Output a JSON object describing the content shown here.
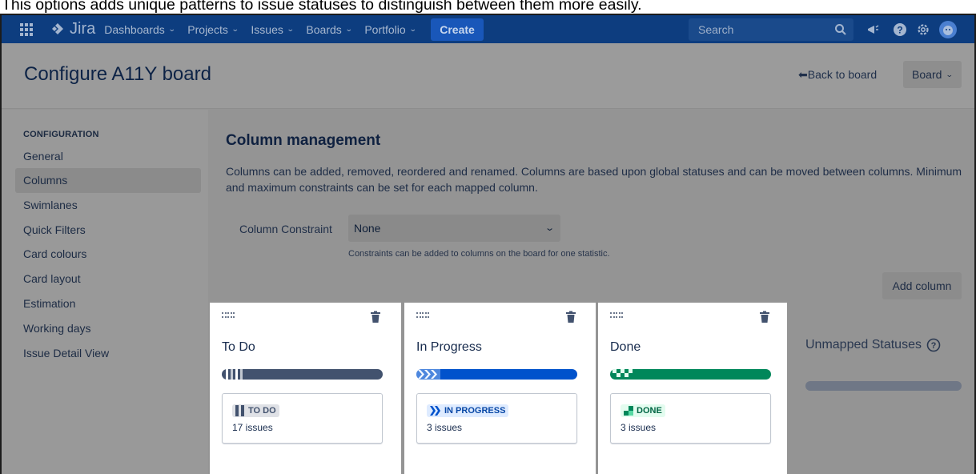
{
  "caption": "This options adds unique patterns to issue statuses to distinguish between them more easily.",
  "nav": {
    "product": "Jira",
    "items": [
      "Dashboards",
      "Projects",
      "Issues",
      "Boards",
      "Portfolio"
    ],
    "create_label": "Create",
    "search_placeholder": "Search"
  },
  "header": {
    "title": "Configure A11Y board",
    "back_label": "Back to board",
    "board_button": "Board"
  },
  "sidebar": {
    "heading": "CONFIGURATION",
    "items": [
      "General",
      "Columns",
      "Swimlanes",
      "Quick Filters",
      "Card colours",
      "Card layout",
      "Estimation",
      "Working days",
      "Issue Detail View"
    ],
    "active": "Columns"
  },
  "main": {
    "title": "Column management",
    "description": "Columns can be added, removed, reordered and renamed. Columns are based upon global statuses and can be moved between columns. Minimum and maximum constraints can be set for each mapped column.",
    "constraint_label": "Column Constraint",
    "constraint_value": "None",
    "constraint_hint": "Constraints can be added to columns on the board for one statistic.",
    "add_column": "Add column"
  },
  "columns": [
    {
      "name": "To Do",
      "status": "TO DO",
      "issues": "17 issues",
      "color": "#42526e",
      "lozenge_bg": "#dfe1e6",
      "lozenge_fg": "#42526e"
    },
    {
      "name": "In Progress",
      "status": "IN PROGRESS",
      "issues": "3 issues",
      "color": "#0052cc",
      "lozenge_bg": "#deebff",
      "lozenge_fg": "#0747a6"
    },
    {
      "name": "Done",
      "status": "DONE",
      "issues": "3 issues",
      "color": "#00875a",
      "lozenge_bg": "#e3fcef",
      "lozenge_fg": "#006644"
    }
  ],
  "unmapped": {
    "label": "Unmapped Statuses"
  }
}
